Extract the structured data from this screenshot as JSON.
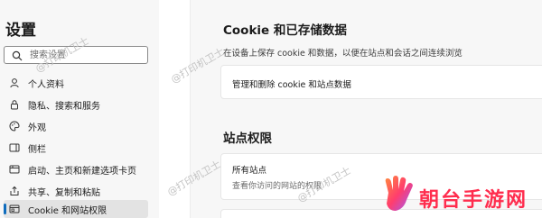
{
  "sidebar": {
    "title": "设置",
    "search_placeholder": "搜索设置",
    "items": [
      {
        "label": "个人资料"
      },
      {
        "label": "隐私、搜索和服务"
      },
      {
        "label": "外观"
      },
      {
        "label": "侧栏"
      },
      {
        "label": "启动、主页和新建选项卡页"
      },
      {
        "label": "共享、复制和粘贴"
      },
      {
        "label": "Cookie 和网站权限",
        "active": true
      }
    ]
  },
  "main": {
    "cookie_section": {
      "title": "Cookie 和已存储数据",
      "description": "在设备上保存 cookie 和数据，以便在站点和会话之间连续浏览",
      "card_label": "管理和删除 cookie 和站点数据"
    },
    "permissions_section": {
      "title": "站点权限",
      "card_title": "所有站点",
      "card_subtitle": "查看你访问的网站的权限"
    }
  },
  "watermark_text": "@打印机卫士",
  "logo_text": "朝台手游网",
  "colors": {
    "accent": "#0f6cbd",
    "logo": "#ff2d4e"
  }
}
